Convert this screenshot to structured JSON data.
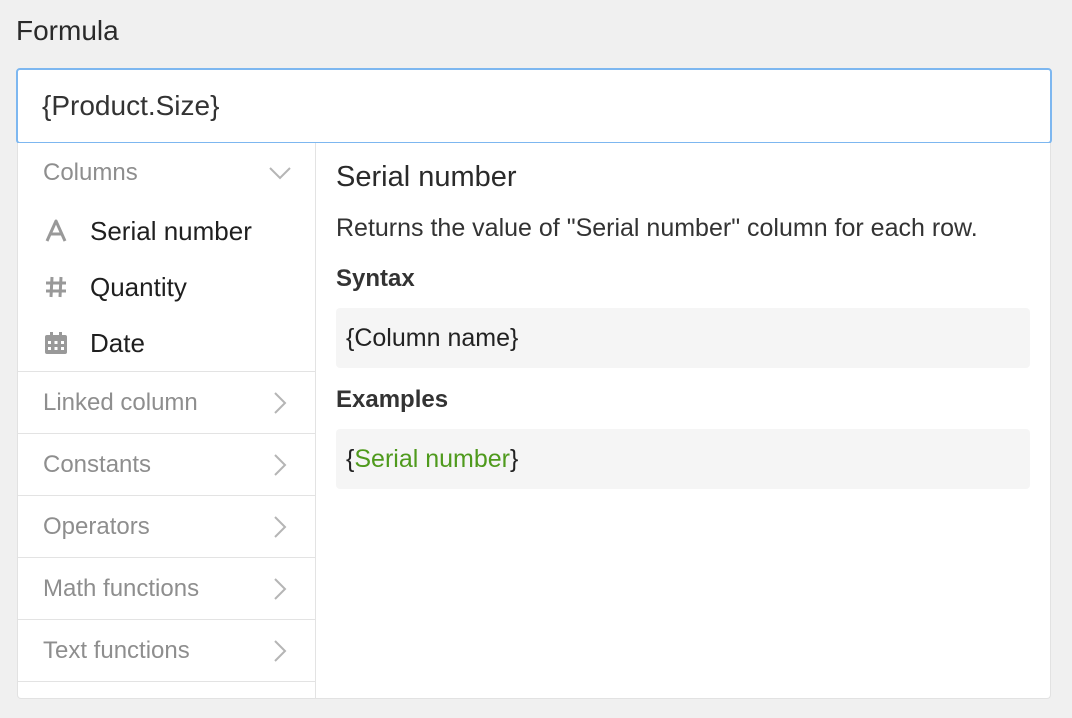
{
  "form": {
    "label": "Formula",
    "value": "{Product.Size}"
  },
  "sidebar": {
    "columns_group": {
      "label": "Columns",
      "items": [
        {
          "label": "Serial number",
          "icon": "text-type-icon"
        },
        {
          "label": "Quantity",
          "icon": "hash-icon"
        },
        {
          "label": "Date",
          "icon": "calendar-icon"
        }
      ]
    },
    "groups": [
      {
        "label": "Linked column"
      },
      {
        "label": "Constants"
      },
      {
        "label": "Operators"
      },
      {
        "label": "Math functions"
      },
      {
        "label": "Text functions"
      }
    ]
  },
  "detail": {
    "title": "Serial number",
    "description": "Returns the value of \"Serial number\" column for each row.",
    "syntax_heading": "Syntax",
    "syntax": "{Column name}",
    "examples_heading": "Examples",
    "example": {
      "prefix": "{",
      "highlight": "Serial number",
      "suffix": "}"
    }
  },
  "colors": {
    "accent_border": "#7db7f0",
    "example_highlight": "#4f9a1d",
    "muted_text": "#8e8e8e"
  }
}
